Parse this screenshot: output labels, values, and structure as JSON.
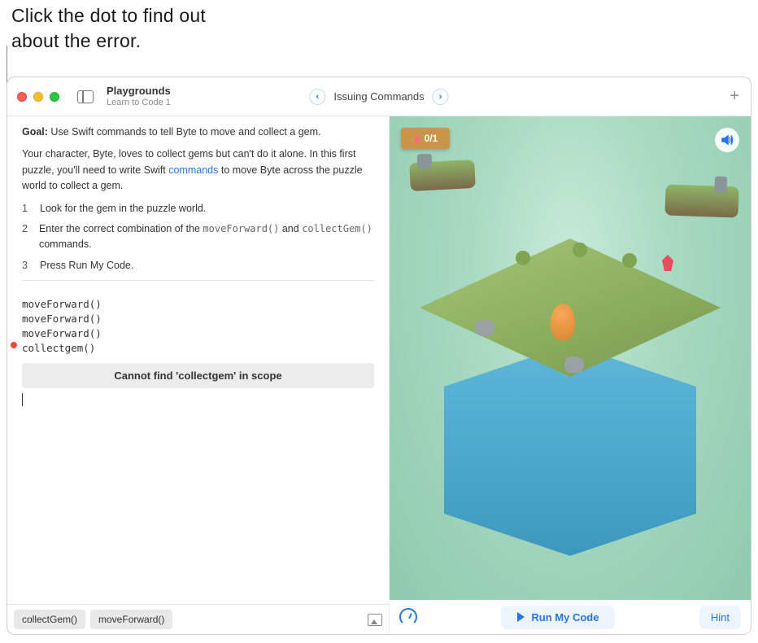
{
  "callout": {
    "line1": "Click the dot to find out",
    "line2": "about the error."
  },
  "header": {
    "app_title": "Playgrounds",
    "subtitle": "Learn to Code 1",
    "page_title": "Issuing Commands"
  },
  "instructions": {
    "goal_label": "Goal:",
    "goal_text": " Use Swift commands to tell Byte to move and collect a gem.",
    "para_before": "Your character, Byte, loves to collect gems but can't do it alone. In this first puzzle, you'll need to write Swift ",
    "commands_link": "commands",
    "para_after": " to move Byte across the puzzle world to collect a gem.",
    "steps": [
      {
        "n": "1",
        "text": "Look for the gem in the puzzle world."
      },
      {
        "n": "2",
        "text_before": "Enter the correct combination of the ",
        "code1": "moveForward()",
        "mid": " and ",
        "code2": "collectGem()",
        "text_after": " commands."
      },
      {
        "n": "3",
        "text": "Press Run My Code."
      }
    ]
  },
  "code": {
    "lines": [
      "moveForward()",
      "moveForward()",
      "moveForward()",
      "collectgem()"
    ]
  },
  "error": {
    "message": "Cannot find 'collectgem' in scope"
  },
  "suggestions": [
    "collectGem()",
    "moveForward()"
  ],
  "scene": {
    "counter": "0/1"
  },
  "footer": {
    "run_label": "Run My Code",
    "hint_label": "Hint"
  }
}
